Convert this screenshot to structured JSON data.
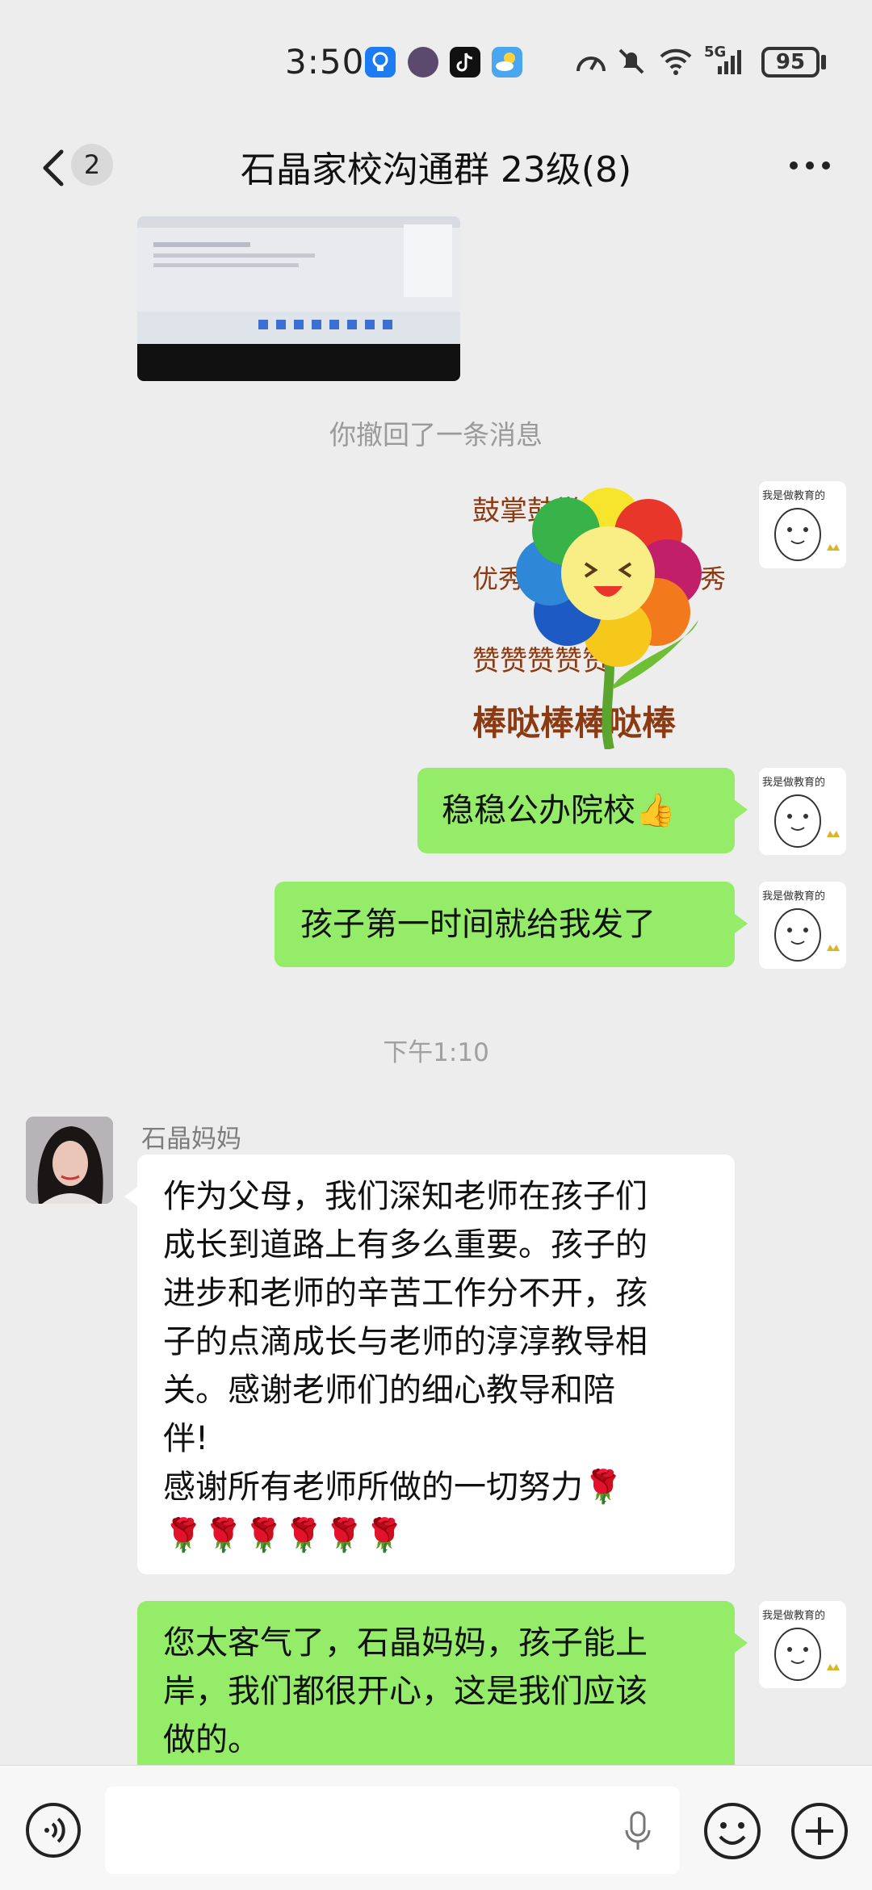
{
  "status_bar": {
    "time": "3:50",
    "battery": "95",
    "network": "5G"
  },
  "header": {
    "unread_count": "2",
    "title": "石晶家校沟通群 23级(8)"
  },
  "messages": {
    "recalled_notice": "你撤回了一条消息",
    "msg1": "稳稳公办院校👍",
    "msg2": "孩子第一时间就给我发了",
    "timestamp": "下午1:10",
    "sender_name": "石晶妈妈",
    "msg3_lines": [
      "作为父母，我们深知老师在孩子们",
      "成长到道路上有多么重要。孩子的",
      "进步和老师的辛苦工作分不开，孩",
      "子的点滴成长与老师的淳淳教导相",
      "关。感谢老师们的细心教导和陪",
      "伴!",
      "感谢所有老师所做的一切努力🌹",
      "🌹🌹🌹🌹🌹🌹"
    ],
    "msg4_lines": [
      "您太客气了，石晶妈妈，孩子能上",
      "岸，我们都很开心，这是我们应该",
      "做的。"
    ]
  },
  "sticker": {
    "top_text": "鼓掌鼓掌",
    "side_text": "优秀",
    "bottom_text": "棒哒棒棒哒棒",
    "row_text": "赞赞赞赞赞"
  },
  "avatar_self_text": "我是做教育的",
  "colors": {
    "bubble_green": "#95ec69",
    "background": "#ededed"
  },
  "icons": {
    "back": "chevron-left-icon",
    "more": "more-horizontal-icon",
    "voice": "voice-icon",
    "mic": "mic-icon",
    "emoji": "emoji-icon",
    "plus": "plus-icon"
  }
}
